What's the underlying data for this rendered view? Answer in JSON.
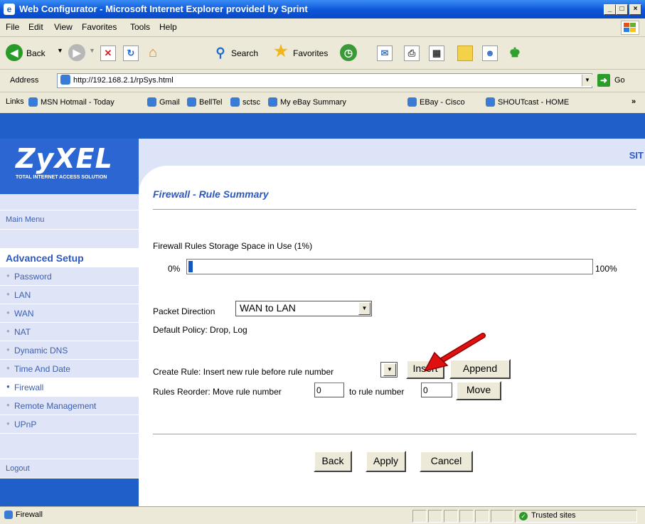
{
  "window": {
    "title": "Web Configurator - Microsoft Internet Explorer provided by Sprint",
    "controls": [
      "_",
      "□",
      "×"
    ]
  },
  "menu": [
    "File",
    "Edit",
    "View",
    "Favorites",
    "Tools",
    "Help"
  ],
  "toolbar": {
    "back": "Back",
    "search": "Search",
    "favorites": "Favorites"
  },
  "address": {
    "label": "Address",
    "url": "http://192.168.2.1/rpSys.html",
    "go": "Go"
  },
  "links": {
    "label": "Links",
    "items": [
      "MSN Hotmail - Today",
      "Gmail",
      "BellTel",
      "sctsc",
      "My eBay Summary",
      "EBay - Cisco",
      "SHOUTcast - HOME"
    ]
  },
  "brand": {
    "logo": "ZyXEL",
    "tagline": "TOTAL INTERNET ACCESS SOLUTION",
    "site_fragment": "SIT"
  },
  "sidebar": {
    "main_menu": "Main Menu",
    "advanced_setup": "Advanced Setup",
    "items": [
      "Password",
      "LAN",
      "WAN",
      "NAT",
      "Dynamic DNS",
      "Time And Date",
      "Firewall",
      "Remote Management",
      "UPnP"
    ],
    "active": "Firewall",
    "logout": "Logout"
  },
  "main": {
    "title": "Firewall - Rule Summary",
    "storage_label": "Firewall Rules Storage Space in Use  (1%)",
    "storage_percent": 1,
    "min_label": "0%",
    "max_label": "100%",
    "packet_direction_label": "Packet Direction",
    "packet_direction_value": "WAN to LAN",
    "default_policy": "Default Policy: Drop, Log",
    "create_rule_label": "Create Rule: Insert new rule before rule number",
    "create_rule_value": "",
    "insert_button": "Insert",
    "append_button": "Append",
    "reorder_label": "Rules Reorder: Move rule number",
    "reorder_from": "0",
    "reorder_to_label": "to rule number",
    "reorder_to": "0",
    "move_button": "Move",
    "back_button": "Back",
    "apply_button": "Apply",
    "cancel_button": "Cancel"
  },
  "status": {
    "left": "Firewall",
    "zone": "Trusted sites"
  },
  "colors": {
    "header_blue": "#1f5fc9",
    "link_blue": "#2b59c3",
    "sidebar_bg": "#dfe4f6",
    "annotation_arrow": "#e01010"
  }
}
